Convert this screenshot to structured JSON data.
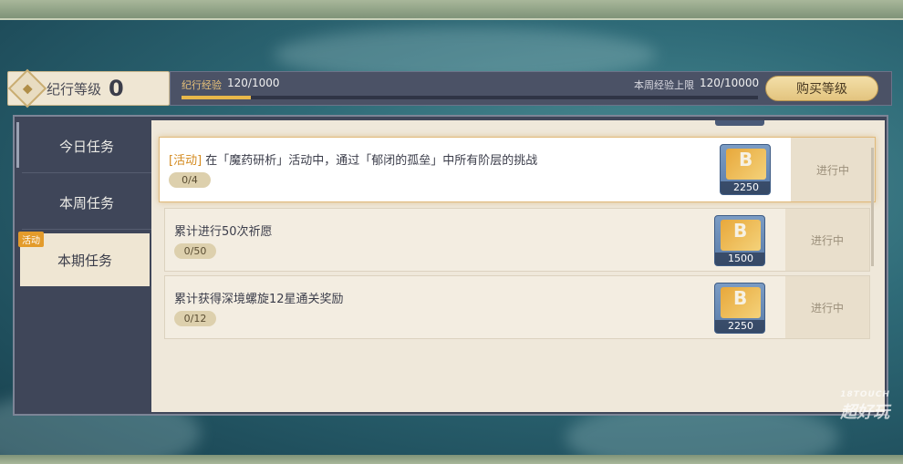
{
  "header": {
    "level_label": "纪行等级",
    "level_value": "0",
    "exp_label": "纪行经验",
    "exp_value": "120/1000",
    "exp_progress": 0.12,
    "week_label": "本周经验上限",
    "week_value": "120/10000",
    "buy_button": "购买等级"
  },
  "sidebar": {
    "items": [
      {
        "label": "今日任务",
        "active": false
      },
      {
        "label": "本周任务",
        "active": false
      },
      {
        "label": "本期任务",
        "active": true
      }
    ],
    "badge": "活动"
  },
  "tasks": [
    {
      "tag": "[活动]",
      "text": " 在「魔药研析」活动中，通过「郁闭的孤垒」中所有阶层的挑战",
      "progress": "0/4",
      "reward": "2250",
      "status": "进行中",
      "highlight": true
    },
    {
      "tag": "",
      "text": "累计进行50次祈愿",
      "progress": "0/50",
      "reward": "1500",
      "status": "进行中",
      "highlight": false
    },
    {
      "tag": "",
      "text": "累计获得深境螺旋12星通关奖励",
      "progress": "0/12",
      "reward": "2250",
      "status": "进行中",
      "highlight": false
    }
  ],
  "watermark": {
    "small": "18TOUCH",
    "big": "超好玩"
  },
  "colors": {
    "accent": "#e8b84a",
    "tag": "#d48a1e",
    "panel": "#3f4659",
    "content": "#efe8da"
  },
  "icons": {
    "level_emblem": "diamond-emblem-icon",
    "reward": "exp-book-icon"
  }
}
